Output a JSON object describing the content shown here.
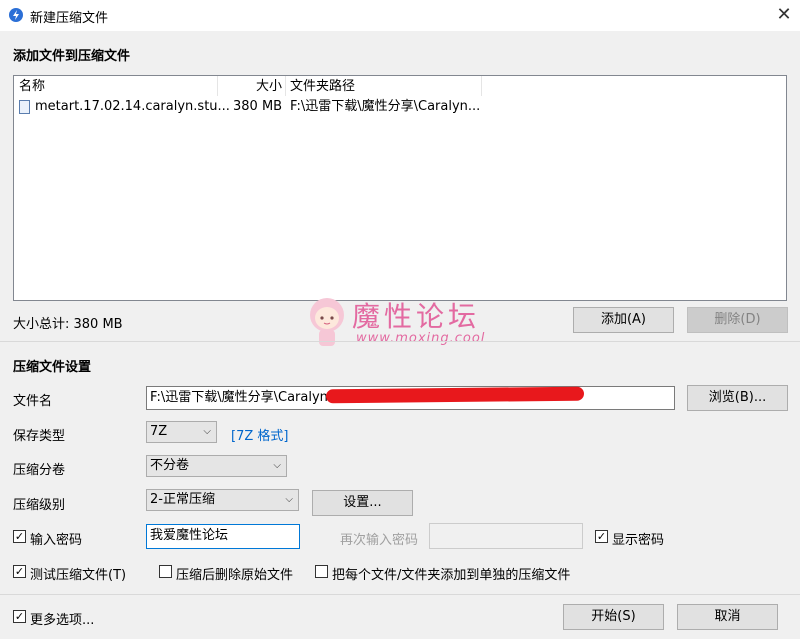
{
  "window": {
    "title": "新建压缩文件",
    "close_glyph": "✕",
    "icon": "app-bolt-icon"
  },
  "files_section": {
    "title": "添加文件到压缩文件",
    "columns": [
      "名称",
      "大小",
      "文件夹路径"
    ],
    "rows": [
      {
        "name": "metart.17.02.14.caralyn.stu...",
        "size": "380 MB",
        "path": "F:\\迅雷下载\\魔性分享\\Caralyn..."
      }
    ],
    "total_label": "大小总计: 380 MB",
    "add_button": "添加(A)",
    "delete_button": "删除(D)"
  },
  "watermark": {
    "text": "魔性论坛",
    "url": "www.moxing.cool"
  },
  "settings": {
    "title": "压缩文件设置",
    "filename_label": "文件名",
    "filename_value": "F:\\迅雷下载\\魔性分享\\Caralyn",
    "browse_button": "浏览(B)...",
    "type_label": "保存类型",
    "type_value": "7Z",
    "format_link": "[7Z 格式]",
    "split_label": "压缩分卷",
    "split_value": "不分卷",
    "level_label": "压缩级别",
    "level_value": "2-正常压缩",
    "setup_button": "设置...",
    "password_checkbox": "输入密码",
    "password_value": "我爱魔性论坛",
    "reenter_label": "再次输入密码",
    "show_password": "显示密码",
    "test_checkbox": "测试压缩文件(T)",
    "delete_original": "压缩后删除原始文件",
    "each_separate": "把每个文件/文件夹添加到单独的压缩文件",
    "more_options": "更多选项...",
    "start_button": "开始(S)",
    "cancel_button": "取消",
    "checked_glyph": "✓"
  },
  "colors": {
    "accent": "#0078d7",
    "link": "#0066cc",
    "watermark": "#e36aa1",
    "redaction": "#e8181c"
  }
}
